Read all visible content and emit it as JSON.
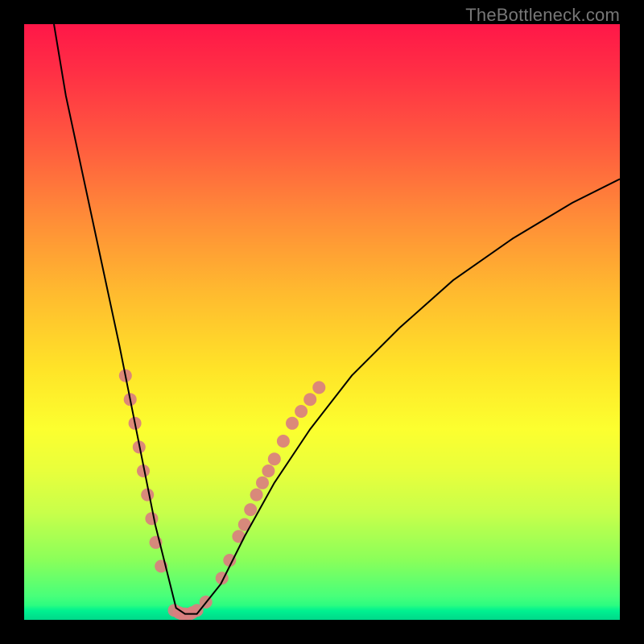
{
  "attribution": "TheBottleneck.com",
  "chart_data": {
    "type": "line",
    "title": "",
    "xlabel": "",
    "ylabel": "",
    "xlim": [
      0,
      100
    ],
    "ylim": [
      0,
      100
    ],
    "grid": false,
    "legend": false,
    "series": [
      {
        "name": "curve",
        "x": [
          5,
          7,
          10,
          13,
          16,
          18,
          20,
          22,
          24,
          25.5,
          27,
          29,
          33,
          37,
          42,
          48,
          55,
          63,
          72,
          82,
          92,
          100
        ],
        "y": [
          100,
          88,
          74,
          60,
          46,
          36,
          26,
          16,
          8,
          2,
          1,
          1,
          6,
          14,
          23,
          32,
          41,
          49,
          57,
          64,
          70,
          74
        ],
        "color": "#000000",
        "line_width": 2
      }
    ],
    "markers": {
      "name": "highlighted-points",
      "color": "#d97f7f",
      "radius": 8,
      "points": [
        {
          "x": 17.0,
          "y": 41
        },
        {
          "x": 17.8,
          "y": 37
        },
        {
          "x": 18.6,
          "y": 33
        },
        {
          "x": 19.3,
          "y": 29
        },
        {
          "x": 20.0,
          "y": 25
        },
        {
          "x": 20.7,
          "y": 21
        },
        {
          "x": 21.4,
          "y": 17
        },
        {
          "x": 22.1,
          "y": 13
        },
        {
          "x": 23.0,
          "y": 9
        },
        {
          "x": 25.2,
          "y": 1.6
        },
        {
          "x": 26.0,
          "y": 1.2
        },
        {
          "x": 26.5,
          "y": 1
        },
        {
          "x": 27.0,
          "y": 1
        },
        {
          "x": 27.8,
          "y": 1
        },
        {
          "x": 28.2,
          "y": 1.2
        },
        {
          "x": 29.0,
          "y": 1.6
        },
        {
          "x": 30.5,
          "y": 3
        },
        {
          "x": 33.2,
          "y": 7
        },
        {
          "x": 34.5,
          "y": 10
        },
        {
          "x": 36.0,
          "y": 14
        },
        {
          "x": 37.0,
          "y": 16
        },
        {
          "x": 38.0,
          "y": 18.5
        },
        {
          "x": 39.0,
          "y": 21
        },
        {
          "x": 40.0,
          "y": 23
        },
        {
          "x": 41.0,
          "y": 25
        },
        {
          "x": 42.0,
          "y": 27
        },
        {
          "x": 43.5,
          "y": 30
        },
        {
          "x": 45.0,
          "y": 33
        },
        {
          "x": 46.5,
          "y": 35
        },
        {
          "x": 48.0,
          "y": 37
        },
        {
          "x": 49.5,
          "y": 39
        }
      ]
    }
  }
}
